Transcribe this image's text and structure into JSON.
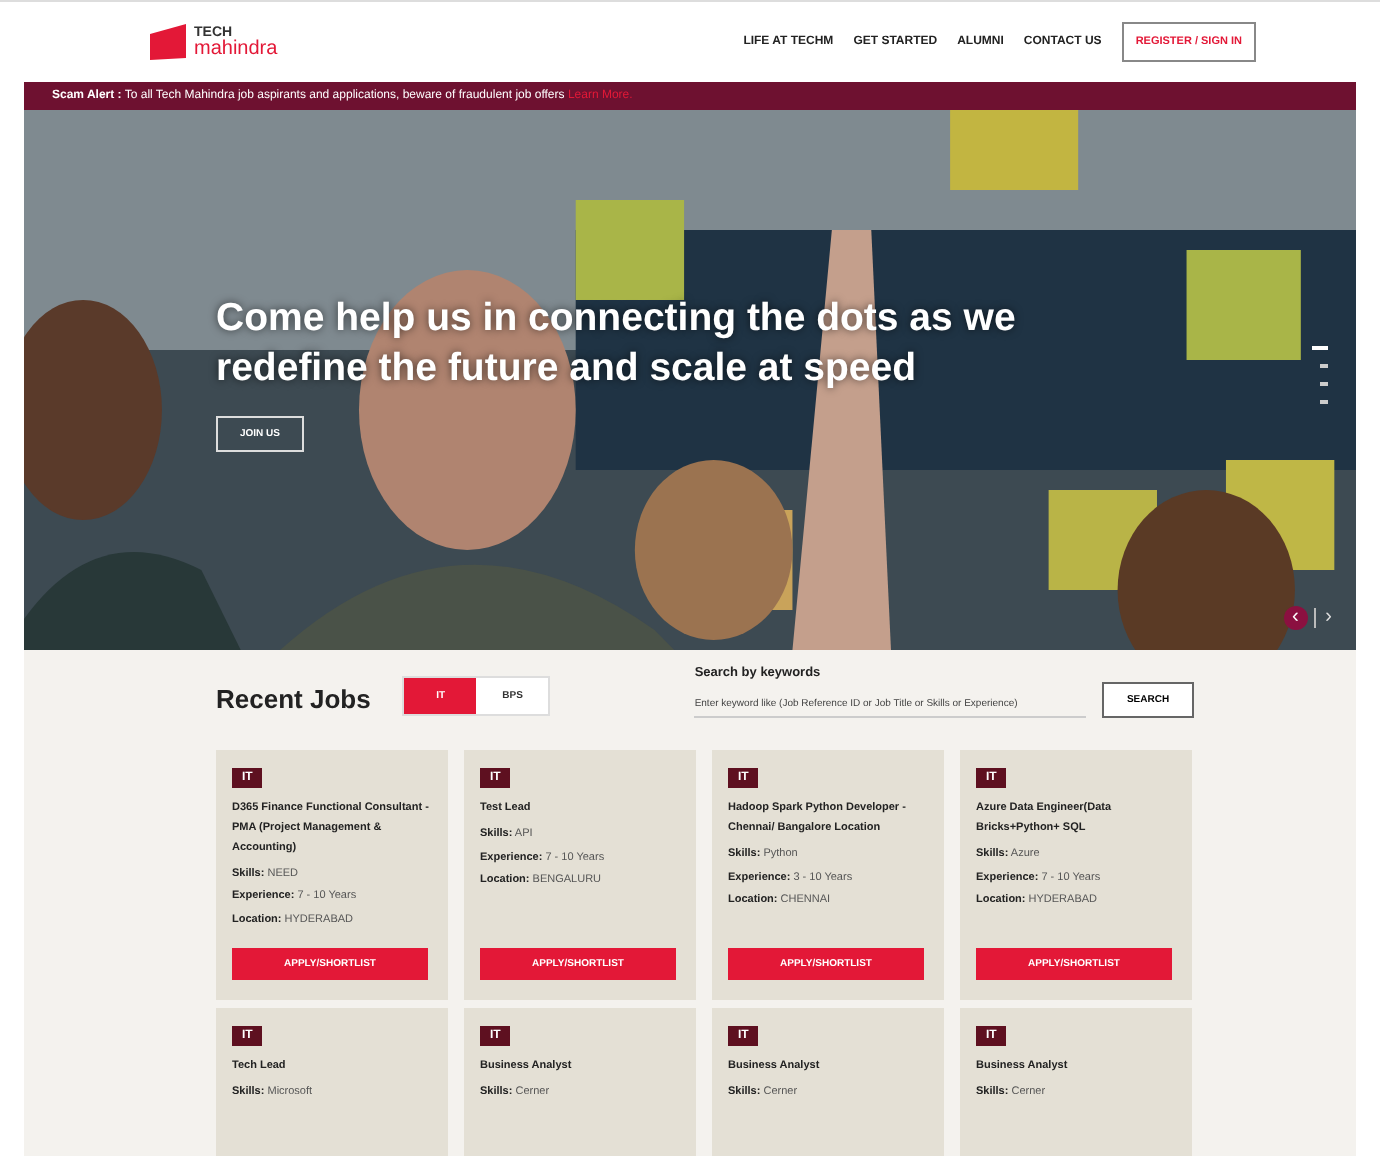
{
  "header": {
    "logo": {
      "line1": "TECH",
      "line2": "mahindra"
    },
    "nav": [
      {
        "label": "LIFE AT TECHM",
        "kind": "link"
      },
      {
        "label": "GET STARTED",
        "kind": "link"
      },
      {
        "label": "ALUMNI",
        "kind": "link"
      },
      {
        "label": "CONTACT US",
        "kind": "link"
      },
      {
        "label": "REGISTER / SIGN IN",
        "kind": "button"
      }
    ]
  },
  "alert": {
    "label": "Scam Alert :",
    "text": "To all Tech Mahindra job aspirants and applications, beware of fraudulent job offers",
    "link": "Learn More."
  },
  "hero": {
    "headline": "Come help us in connecting the dots as we redefine the future and scale at speed",
    "cta": "JOIN US",
    "slides": [
      {
        "selected": true
      },
      {
        "selected": false
      },
      {
        "selected": false
      },
      {
        "selected": false
      }
    ],
    "prev": "‹",
    "next": "›"
  },
  "jobs": {
    "title": "Recent Jobs",
    "tabs": [
      {
        "label": "IT",
        "selected": true
      },
      {
        "label": "BPS",
        "selected": false
      }
    ],
    "search": {
      "label": "Search by keywords",
      "placeholder": "Enter keyword like (Job Reference ID or Job Title or Skills or Experience)",
      "button": "SEARCH"
    },
    "cards": [
      {
        "tag": "IT",
        "title": "D365 Finance Functional Consultant - PMA (Project Management & Accounting)",
        "fields": [
          {
            "label": "Skills:",
            "value": "NEED"
          },
          {
            "label": "Experience:",
            "value": "7 - 10 Years"
          },
          {
            "label": "Location:",
            "value": "HYDERABAD"
          }
        ],
        "button": "APPLY/SHORTLIST"
      },
      {
        "tag": "IT",
        "title": "Test Lead",
        "fields": [
          {
            "label": "Skills:",
            "value": "API"
          },
          {
            "label": "Experience:",
            "value": "7 - 10 Years"
          },
          {
            "label": "Location:",
            "value": "BENGALURU"
          }
        ],
        "button": "APPLY/SHORTLIST"
      },
      {
        "tag": "IT",
        "title": "Hadoop Spark Python Developer - Chennai/ Bangalore Location",
        "fields": [
          {
            "label": "Skills:",
            "value": "Python"
          },
          {
            "label": "Experience:",
            "value": "3 - 10 Years"
          },
          {
            "label": "Location:",
            "value": "CHENNAI"
          }
        ],
        "button": "APPLY/SHORTLIST"
      },
      {
        "tag": "IT",
        "title": "Azure Data Engineer(Data Bricks+Python+ SQL",
        "fields": [
          {
            "label": "Skills:",
            "value": "Azure"
          },
          {
            "label": "Experience:",
            "value": "7 - 10 Years"
          },
          {
            "label": "Location:",
            "value": "HYDERABAD"
          }
        ],
        "button": "APPLY/SHORTLIST"
      },
      {
        "tag": "IT",
        "title": "Tech Lead",
        "fields": [
          {
            "label": "Skills:",
            "value": "Microsoft"
          }
        ]
      },
      {
        "tag": "IT",
        "title": "Business Analyst",
        "fields": [
          {
            "label": "Skills:",
            "value": "Cerner"
          }
        ]
      },
      {
        "tag": "IT",
        "title": "Business Analyst",
        "fields": [
          {
            "label": "Skills:",
            "value": "Cerner"
          }
        ]
      },
      {
        "tag": "IT",
        "title": "Business Analyst",
        "fields": [
          {
            "label": "Skills:",
            "value": "Cerner"
          }
        ]
      }
    ]
  }
}
